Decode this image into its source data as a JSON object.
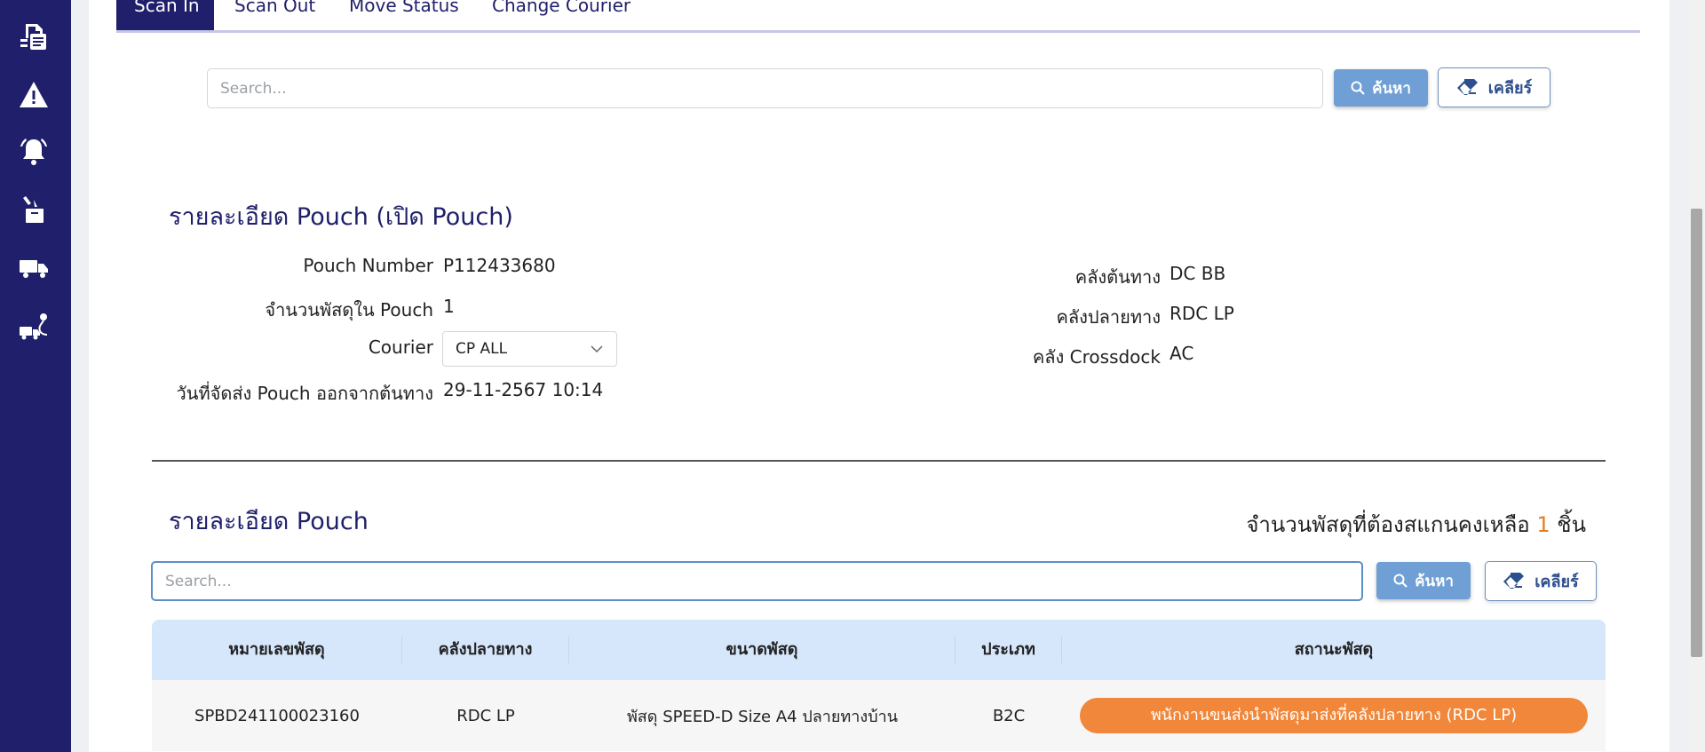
{
  "sidebar": {
    "items": [
      {
        "icon": "document-list-icon"
      },
      {
        "icon": "warning-icon"
      },
      {
        "icon": "bell-icon"
      },
      {
        "icon": "box-pickup-icon"
      },
      {
        "icon": "truck-icon"
      },
      {
        "icon": "truck-route-icon"
      }
    ]
  },
  "tabs": [
    {
      "label": "Scan In",
      "active": true
    },
    {
      "label": "Scan Out",
      "active": false
    },
    {
      "label": "Move Status",
      "active": false
    },
    {
      "label": "Change Courier",
      "active": false
    }
  ],
  "top_search": {
    "placeholder": "Search...",
    "value": "",
    "search_label": "ค้นหา",
    "clear_label": "เคลียร์"
  },
  "pouch_open": {
    "title": "รายละเอียด Pouch (เปิด Pouch)",
    "pouch_number_label": "Pouch Number",
    "pouch_number": "P112433680",
    "parcel_count_label": "จำนวนพัสดุใน Pouch",
    "parcel_count": "1",
    "courier_label": "Courier",
    "courier_selected": "CP ALL",
    "ship_date_label": "วันที่จัดส่ง Pouch ออกจากต้นทาง",
    "ship_date": "29-11-2567 10:14",
    "origin_label": "คลังต้นทาง",
    "origin": "DC BB",
    "destination_label": "คลังปลายทาง",
    "destination": "RDC LP",
    "crossdock_label": "คลัง Crossdock",
    "crossdock": "AC"
  },
  "pouch_detail": {
    "title": "รายละเอียด Pouch",
    "remaining_prefix": "จำนวนพัสดุที่ต้องสแกนคงเหลือ",
    "remaining_count": "1",
    "remaining_suffix": "ชิ้น",
    "search": {
      "placeholder": "Search...",
      "value": "",
      "search_label": "ค้นหา",
      "clear_label": "เคลียร์"
    },
    "columns": [
      "หมายเลขพัสดุ",
      "คลังปลายทาง",
      "ขนาดพัสดุ",
      "ประเภท",
      "สถานะพัสดุ"
    ],
    "rows": [
      {
        "tracking": "SPBD241100023160",
        "destination": "RDC LP",
        "size": "พัสดุ SPEED-D Size A4 ปลายทางบ้าน",
        "type": "B2C",
        "status": "พนักงานขนส่งนำพัสดุมาส่งที่คลังปลายทาง (RDC LP)"
      }
    ]
  },
  "colors": {
    "sidebar": "#1f1f6b",
    "accent": "#6f9fd4",
    "status_orange": "#f0873a",
    "table_header": "#d6e6fb"
  }
}
